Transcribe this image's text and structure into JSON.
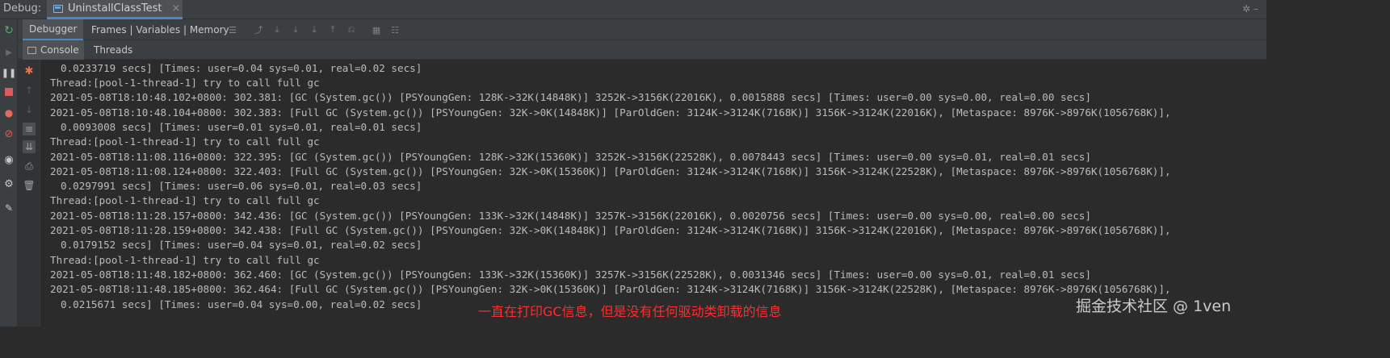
{
  "topbar": {
    "label": "Debug:",
    "tab_title": "UninstallClassTest",
    "tab_close": "×",
    "right_controls": "✲ –"
  },
  "toolbar": {
    "debugger_tab": "Debugger",
    "frames_tab": "Frames | Variables | Memory"
  },
  "console_tabs": {
    "console": "Console",
    "threads": "Threads"
  },
  "console_lines": [
    "0.0233719 secs] [Times: user=0.04 sys=0.01, real=0.02 secs]",
    "Thread:[pool-1-thread-1] try to call full gc",
    "2021-05-08T18:10:48.102+0800: 302.381: [GC (System.gc()) [PSYoungGen: 128K->32K(14848K)] 3252K->3156K(22016K), 0.0015888 secs] [Times: user=0.00 sys=0.00, real=0.00 secs]",
    "2021-05-08T18:10:48.104+0800: 302.383: [Full GC (System.gc()) [PSYoungGen: 32K->0K(14848K)] [ParOldGen: 3124K->3124K(7168K)] 3156K->3124K(22016K), [Metaspace: 8976K->8976K(1056768K)],",
    "0.0093008 secs] [Times: user=0.01 sys=0.01, real=0.01 secs]",
    "Thread:[pool-1-thread-1] try to call full gc",
    "2021-05-08T18:11:08.116+0800: 322.395: [GC (System.gc()) [PSYoungGen: 128K->32K(15360K)] 3252K->3156K(22528K), 0.0078443 secs] [Times: user=0.00 sys=0.01, real=0.01 secs]",
    "2021-05-08T18:11:08.124+0800: 322.403: [Full GC (System.gc()) [PSYoungGen: 32K->0K(15360K)] [ParOldGen: 3124K->3124K(7168K)] 3156K->3124K(22528K), [Metaspace: 8976K->8976K(1056768K)],",
    "0.0297991 secs] [Times: user=0.06 sys=0.01, real=0.03 secs]",
    "Thread:[pool-1-thread-1] try to call full gc",
    "2021-05-08T18:11:28.157+0800: 342.436: [GC (System.gc()) [PSYoungGen: 133K->32K(14848K)] 3257K->3156K(22016K), 0.0020756 secs] [Times: user=0.00 sys=0.00, real=0.00 secs]",
    "2021-05-08T18:11:28.159+0800: 342.438: [Full GC (System.gc()) [PSYoungGen: 32K->0K(14848K)] [ParOldGen: 3124K->3124K(7168K)] 3156K->3124K(22016K), [Metaspace: 8976K->8976K(1056768K)],",
    "0.0179152 secs] [Times: user=0.04 sys=0.01, real=0.02 secs]",
    "Thread:[pool-1-thread-1] try to call full gc",
    "2021-05-08T18:11:48.182+0800: 362.460: [GC (System.gc()) [PSYoungGen: 133K->32K(15360K)] 3257K->3156K(22528K), 0.0031346 secs] [Times: user=0.00 sys=0.01, real=0.01 secs]",
    "2021-05-08T18:11:48.185+0800: 362.464: [Full GC (System.gc()) [PSYoungGen: 32K->0K(15360K)] [ParOldGen: 3124K->3124K(7168K)] 3156K->3124K(22528K), [Metaspace: 8976K->8976K(1056768K)],",
    "0.0215671 secs] [Times: user=0.04 sys=0.00, real=0.02 secs]"
  ],
  "annotation": "一直在打印GC信息，但是没有任何驱动类卸载的信息",
  "watermark": "掘金技术社区 @ 1ven",
  "colors": {
    "background": "#2b2b2b",
    "panel": "#3c3f41",
    "accent": "#4a88c7",
    "console_text": "#bbbbbb",
    "annotation": "#ff2d2d",
    "rerun_green": "#59a869",
    "stop_red": "#db5c5c",
    "breakpoint_orange": "#e8734a"
  }
}
